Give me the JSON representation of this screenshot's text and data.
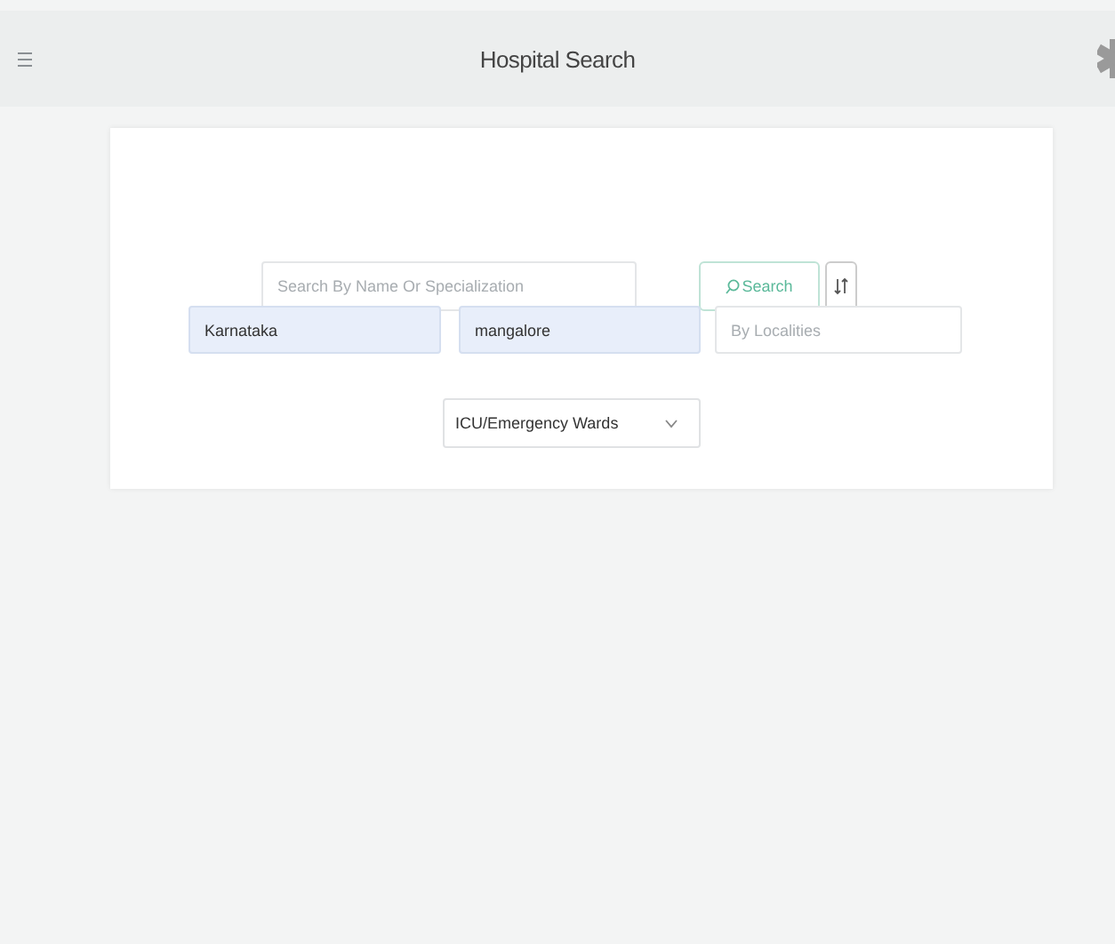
{
  "header": {
    "title": "Hospital Search"
  },
  "search": {
    "placeholder": "Search By Name Or Specialization",
    "button": "Search"
  },
  "filters": [
    {
      "kind": "filled",
      "value": "Karnataka"
    },
    {
      "kind": "filled",
      "value": "mangalore"
    },
    {
      "kind": "empty",
      "placeholder": "By Localities"
    }
  ],
  "ward_select": {
    "value": "ICU/Emergency Wards"
  }
}
